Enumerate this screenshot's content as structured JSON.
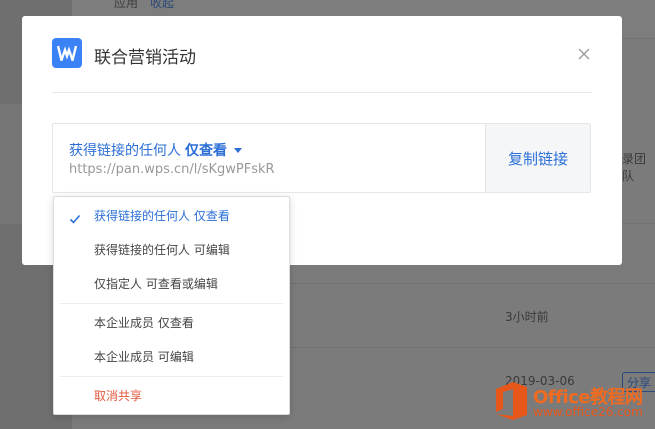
{
  "background": {
    "topbar_text1": "应用",
    "topbar_text2": "收起",
    "row_time_1": "3小时前",
    "row_time_2": "2019-03-06",
    "team_text": "录团队",
    "share_label": "分享"
  },
  "modal": {
    "logo_icon": "wps-w-icon",
    "title": "联合营销活动",
    "close_icon": "close-icon",
    "permission_target": "获得链接的任何人",
    "permission_mode": "仅查看",
    "share_url": "https://pan.wps.cn/l/sKgwPFskR",
    "copy_label": "复制链接"
  },
  "dropdown": {
    "items": [
      {
        "label": "获得链接的任何人 仅查看",
        "selected": true
      },
      {
        "label": "获得链接的任何人 可编辑"
      },
      {
        "label": "仅指定人 可查看或编辑"
      },
      {
        "label": "本企业成员 仅查看"
      },
      {
        "label": "本企业成员 可编辑"
      },
      {
        "label": "取消共享"
      }
    ]
  },
  "watermark": {
    "line1": "Office教程网",
    "line2": "www.office26.com"
  },
  "colors": {
    "accent": "#2b6fd6",
    "logo": "#3b82f6",
    "danger": "#e2583e"
  }
}
